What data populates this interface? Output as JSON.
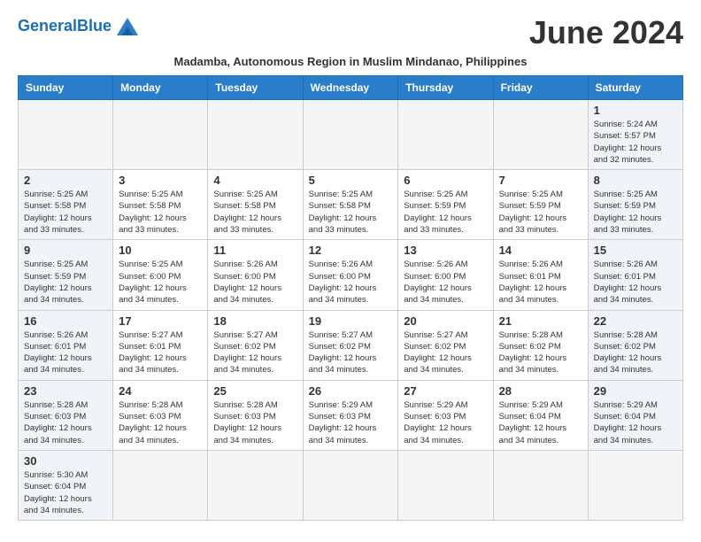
{
  "header": {
    "logo_general": "General",
    "logo_blue": "Blue",
    "month_title": "June 2024",
    "subtitle": "Madamba, Autonomous Region in Muslim Mindanao, Philippines"
  },
  "days_of_week": [
    "Sunday",
    "Monday",
    "Tuesday",
    "Wednesday",
    "Thursday",
    "Friday",
    "Saturday"
  ],
  "weeks": [
    [
      {
        "day": "",
        "info": ""
      },
      {
        "day": "",
        "info": ""
      },
      {
        "day": "",
        "info": ""
      },
      {
        "day": "",
        "info": ""
      },
      {
        "day": "",
        "info": ""
      },
      {
        "day": "",
        "info": ""
      },
      {
        "day": "1",
        "info": "Sunrise: 5:24 AM\nSunset: 5:57 PM\nDaylight: 12 hours and 32 minutes."
      }
    ],
    [
      {
        "day": "2",
        "info": "Sunrise: 5:25 AM\nSunset: 5:58 PM\nDaylight: 12 hours and 33 minutes."
      },
      {
        "day": "3",
        "info": "Sunrise: 5:25 AM\nSunset: 5:58 PM\nDaylight: 12 hours and 33 minutes."
      },
      {
        "day": "4",
        "info": "Sunrise: 5:25 AM\nSunset: 5:58 PM\nDaylight: 12 hours and 33 minutes."
      },
      {
        "day": "5",
        "info": "Sunrise: 5:25 AM\nSunset: 5:58 PM\nDaylight: 12 hours and 33 minutes."
      },
      {
        "day": "6",
        "info": "Sunrise: 5:25 AM\nSunset: 5:59 PM\nDaylight: 12 hours and 33 minutes."
      },
      {
        "day": "7",
        "info": "Sunrise: 5:25 AM\nSunset: 5:59 PM\nDaylight: 12 hours and 33 minutes."
      },
      {
        "day": "8",
        "info": "Sunrise: 5:25 AM\nSunset: 5:59 PM\nDaylight: 12 hours and 33 minutes."
      }
    ],
    [
      {
        "day": "9",
        "info": "Sunrise: 5:25 AM\nSunset: 5:59 PM\nDaylight: 12 hours and 34 minutes."
      },
      {
        "day": "10",
        "info": "Sunrise: 5:25 AM\nSunset: 6:00 PM\nDaylight: 12 hours and 34 minutes."
      },
      {
        "day": "11",
        "info": "Sunrise: 5:26 AM\nSunset: 6:00 PM\nDaylight: 12 hours and 34 minutes."
      },
      {
        "day": "12",
        "info": "Sunrise: 5:26 AM\nSunset: 6:00 PM\nDaylight: 12 hours and 34 minutes."
      },
      {
        "day": "13",
        "info": "Sunrise: 5:26 AM\nSunset: 6:00 PM\nDaylight: 12 hours and 34 minutes."
      },
      {
        "day": "14",
        "info": "Sunrise: 5:26 AM\nSunset: 6:01 PM\nDaylight: 12 hours and 34 minutes."
      },
      {
        "day": "15",
        "info": "Sunrise: 5:26 AM\nSunset: 6:01 PM\nDaylight: 12 hours and 34 minutes."
      }
    ],
    [
      {
        "day": "16",
        "info": "Sunrise: 5:26 AM\nSunset: 6:01 PM\nDaylight: 12 hours and 34 minutes."
      },
      {
        "day": "17",
        "info": "Sunrise: 5:27 AM\nSunset: 6:01 PM\nDaylight: 12 hours and 34 minutes."
      },
      {
        "day": "18",
        "info": "Sunrise: 5:27 AM\nSunset: 6:02 PM\nDaylight: 12 hours and 34 minutes."
      },
      {
        "day": "19",
        "info": "Sunrise: 5:27 AM\nSunset: 6:02 PM\nDaylight: 12 hours and 34 minutes."
      },
      {
        "day": "20",
        "info": "Sunrise: 5:27 AM\nSunset: 6:02 PM\nDaylight: 12 hours and 34 minutes."
      },
      {
        "day": "21",
        "info": "Sunrise: 5:28 AM\nSunset: 6:02 PM\nDaylight: 12 hours and 34 minutes."
      },
      {
        "day": "22",
        "info": "Sunrise: 5:28 AM\nSunset: 6:02 PM\nDaylight: 12 hours and 34 minutes."
      }
    ],
    [
      {
        "day": "23",
        "info": "Sunrise: 5:28 AM\nSunset: 6:03 PM\nDaylight: 12 hours and 34 minutes."
      },
      {
        "day": "24",
        "info": "Sunrise: 5:28 AM\nSunset: 6:03 PM\nDaylight: 12 hours and 34 minutes."
      },
      {
        "day": "25",
        "info": "Sunrise: 5:28 AM\nSunset: 6:03 PM\nDaylight: 12 hours and 34 minutes."
      },
      {
        "day": "26",
        "info": "Sunrise: 5:29 AM\nSunset: 6:03 PM\nDaylight: 12 hours and 34 minutes."
      },
      {
        "day": "27",
        "info": "Sunrise: 5:29 AM\nSunset: 6:03 PM\nDaylight: 12 hours and 34 minutes."
      },
      {
        "day": "28",
        "info": "Sunrise: 5:29 AM\nSunset: 6:04 PM\nDaylight: 12 hours and 34 minutes."
      },
      {
        "day": "29",
        "info": "Sunrise: 5:29 AM\nSunset: 6:04 PM\nDaylight: 12 hours and 34 minutes."
      }
    ],
    [
      {
        "day": "30",
        "info": "Sunrise: 5:30 AM\nSunset: 6:04 PM\nDaylight: 12 hours and 34 minutes."
      },
      {
        "day": "",
        "info": ""
      },
      {
        "day": "",
        "info": ""
      },
      {
        "day": "",
        "info": ""
      },
      {
        "day": "",
        "info": ""
      },
      {
        "day": "",
        "info": ""
      },
      {
        "day": "",
        "info": ""
      }
    ]
  ]
}
